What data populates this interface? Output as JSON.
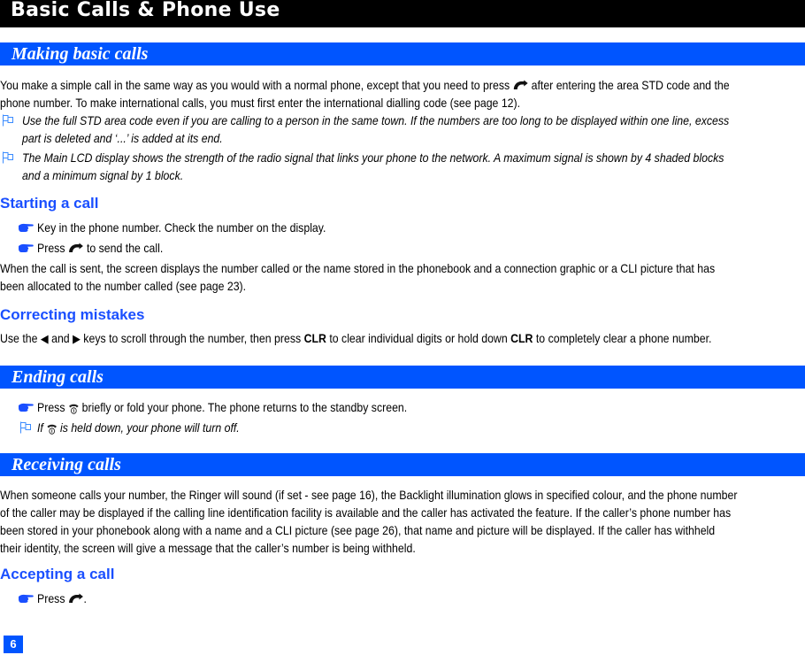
{
  "chapter": {
    "title": "Basic Calls & Phone Use"
  },
  "sections": {
    "making": {
      "title": "Making basic calls",
      "intro": [
        "You make a simple call in the same way as you would with a normal phone, except that you need to press",
        "after entering the area STD code and the",
        "phone number. To make international calls, you must first enter the international dialling code (see page 12)."
      ],
      "notes": [
        [
          "Use the full STD area code even if you are calling to a person in the same town. If the numbers are too long to be displayed within one line, excess",
          "part is deleted and ‘...’ is added at its end."
        ],
        [
          "The Main LCD display shows the strength of the radio signal that links your phone to the network. A maximum signal is shown by 4 shaded blocks",
          "and a minimum signal by 1 block."
        ]
      ]
    },
    "starting": {
      "heading": "Starting a call",
      "bullet1": "Key in the phone number. Check the number on the display.",
      "bullet2_pre": "Press",
      "bullet2_post": "to send the call.",
      "para": [
        "When the call is sent, the screen displays the number called or the name stored in the phonebook and a connection graphic or a CLI picture that has",
        "been allocated to the number called (see page 23)."
      ]
    },
    "correcting": {
      "heading": "Correcting mistakes",
      "p1": "Use the",
      "p2": "and",
      "p3": "keys to scroll through the number, then press",
      "key1": "CLR",
      "p4": "to clear individual digits or hold down",
      "key2": "CLR",
      "p5": "to completely clear a phone number."
    },
    "ending": {
      "title": "Ending calls",
      "bullet_pre": "Press",
      "bullet_post": "briefly or fold your phone. The phone returns to the standby screen.",
      "note_pre": "If",
      "note_post": "is held down, your phone will turn off."
    },
    "receiving": {
      "title": "Receiving calls",
      "para": [
        "When someone calls your number, the Ringer will sound (if set - see page 16), the Backlight illumination glows in specified colour, and the phone number",
        "of the caller may be displayed if the calling line identification facility is available and the caller has activated the feature. If the caller’s phone number has",
        "been stored in your phonebook along with a name and a CLI picture (see page 26), that name and picture will be displayed. If the caller has withheld",
        "their identity, the screen will give a message that the caller’s number is being withheld."
      ]
    },
    "accepting": {
      "heading": "Accepting a call",
      "bullet_pre": "Press",
      "bullet_post": "."
    }
  },
  "icons": {
    "note": "note-flag-icon",
    "bullet": "pointing-hand-icon",
    "send": "phone-send-icon",
    "end": "phone-end-icon",
    "left": "◀",
    "right": "▶"
  },
  "page_number": "6",
  "colors": {
    "section_bar": "#0055ff",
    "subhead": "#1a4fff",
    "chapter_bar": "#000000"
  }
}
